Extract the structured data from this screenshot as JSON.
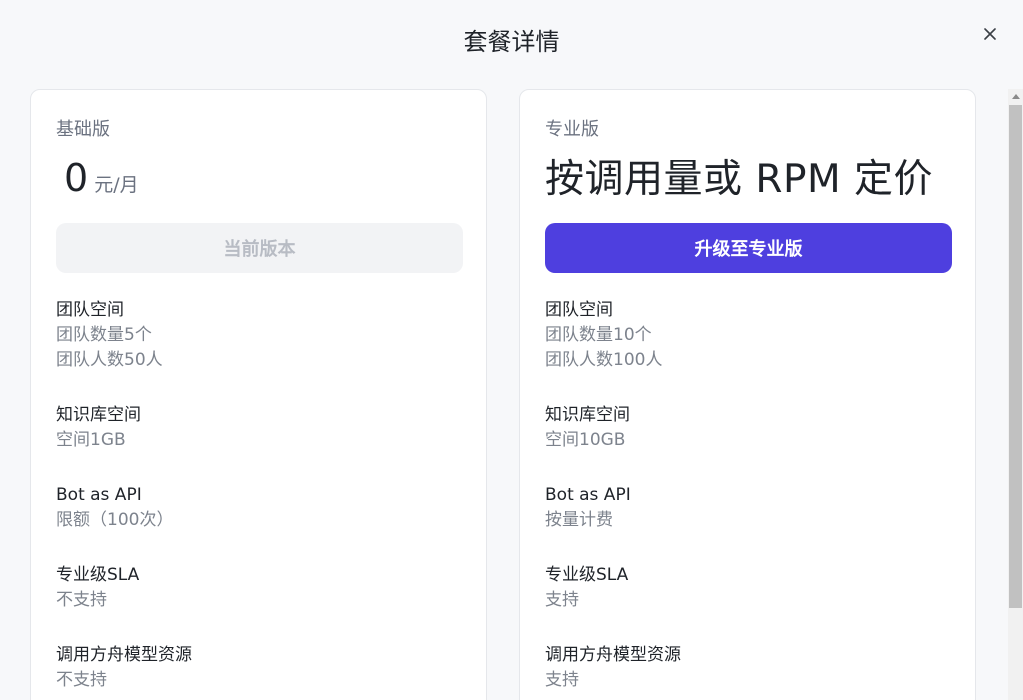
{
  "modal": {
    "title": "套餐详情"
  },
  "icons": {
    "close": "close-icon",
    "scroll_up": "scroll-up-arrow-icon"
  },
  "colors": {
    "primary": "#4e3fdf",
    "disabled_bg": "#f2f3f5",
    "disabled_text": "#b8bcc4",
    "muted_text": "#7d838d",
    "heading_text": "#1f2329"
  },
  "plans": [
    {
      "name": "基础版",
      "price_value": "0",
      "price_unit": "元/月",
      "button_label": "当前版本",
      "features": [
        {
          "title": "团队空间",
          "lines": [
            "团队数量5个",
            "团队人数50人"
          ]
        },
        {
          "title": "知识库空间",
          "lines": [
            "空间1GB"
          ]
        },
        {
          "title": "Bot as API",
          "lines": [
            "限额（100次）"
          ]
        },
        {
          "title": "专业级SLA",
          "lines": [
            "不支持"
          ]
        },
        {
          "title": "调用方舟模型资源",
          "lines": [
            "不支持"
          ]
        }
      ]
    },
    {
      "name": "专业版",
      "price_text": "按调用量或 RPM 定价",
      "button_label": "升级至专业版",
      "features": [
        {
          "title": "团队空间",
          "lines": [
            "团队数量10个",
            "团队人数100人"
          ]
        },
        {
          "title": "知识库空间",
          "lines": [
            "空间10GB"
          ]
        },
        {
          "title": "Bot as API",
          "lines": [
            "按量计费"
          ]
        },
        {
          "title": "专业级SLA",
          "lines": [
            "支持"
          ]
        },
        {
          "title": "调用方舟模型资源",
          "lines": [
            "支持"
          ]
        }
      ]
    }
  ]
}
